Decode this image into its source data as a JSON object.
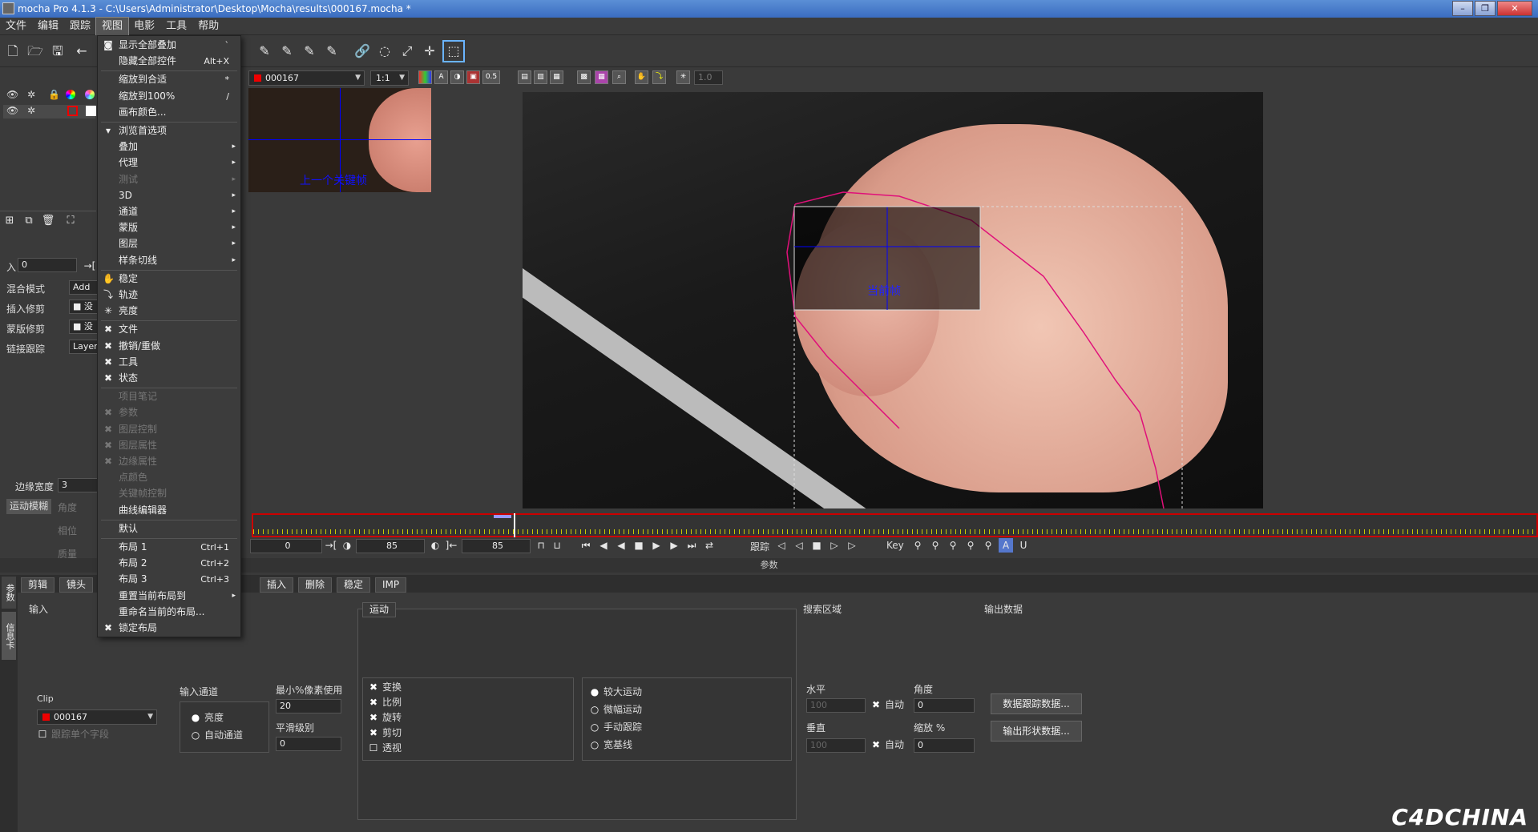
{
  "window": {
    "title": "mocha Pro 4.1.3 - C:\\Users\\Administrator\\Desktop\\Mocha\\results\\000167.mocha *",
    "minimize": "–",
    "restore": "❐",
    "close": "✕"
  },
  "menubar": [
    "文件",
    "编辑",
    "跟踪",
    "视图",
    "电影",
    "工具",
    "帮助"
  ],
  "clip_select": "000167",
  "zoom_select": "1:1",
  "opacity_value": "0.5",
  "speed_field": "1.0",
  "left": {
    "in_label": "入",
    "in_value": "0",
    "blend_label": "混合模式",
    "blend_value": "Add",
    "insert_label": "插入修剪",
    "mask_label": "蒙版修剪",
    "link_label": "链接跟踪",
    "link_value": "Layer",
    "edge_width_label": "边缘宽度",
    "edge_width_value": "3",
    "motion_blur_label": "运动模糊",
    "angle_label": "角度",
    "phase_label": "相位",
    "quality_label": "质量",
    "trunc": "没"
  },
  "thumb": {
    "label": "上一个关键帧"
  },
  "viewer": {
    "overlay_label": "当前帧"
  },
  "transport": {
    "in_value": "0",
    "frame1": "85",
    "frame2": "85",
    "track_label": "跟踪",
    "key_label": "Key"
  },
  "params_label": "参数",
  "tabs": [
    "剪辑",
    "镜头",
    "插入",
    "删除",
    "稳定",
    "IMP"
  ],
  "sidetabs": [
    "参数",
    "信息卡"
  ],
  "bottom": {
    "input_label": "输入",
    "clip_label": "Clip",
    "clip_value": "000167",
    "track_single": "跟踪单个字段",
    "input_channel_label": "输入通道",
    "luma": "亮度",
    "auto_channel": "自动通道",
    "min_pixel_label": "最小%像素使用",
    "min_pixel_value": "20",
    "smooth_label": "平滑级别",
    "smooth_value": "0",
    "motion_tab": "运动",
    "motion_checks": [
      "变换",
      "比例",
      "旋转",
      "剪切",
      "透视"
    ],
    "motion_radios": [
      "较大运动",
      "微幅运动",
      "手动跟踪",
      "宽基线"
    ],
    "search_label": "搜索区域",
    "output_label": "输出数据",
    "horiz_label": "水平",
    "vert_label": "垂直",
    "auto_label": "自动",
    "angle_label": "角度",
    "angle_value": "0",
    "zoom_label": "缩放 %",
    "zoom_value": "0",
    "h_value": "100",
    "v_value": "100",
    "export_track": "数据跟踪数据...",
    "export_shape": "输出形状数据..."
  },
  "menu": {
    "items": [
      {
        "label": "显示全部叠加",
        "shortcut": "`",
        "check": "◙"
      },
      {
        "label": "隐藏全部控件",
        "shortcut": "Alt+X",
        "check": ""
      },
      {
        "label": "缩放到合适",
        "shortcut": "*",
        "check": ""
      },
      {
        "label": "缩放到100%",
        "shortcut": "/",
        "check": ""
      },
      {
        "label": "画布颜色...",
        "shortcut": "",
        "check": ""
      },
      {
        "label": "浏览首选项",
        "shortcut": "",
        "check": "▾"
      },
      {
        "label": "叠加",
        "sub": "▸"
      },
      {
        "label": "代理",
        "sub": "▸"
      },
      {
        "label": "测试",
        "sub": "▸",
        "dis": true
      },
      {
        "label": "3D",
        "sub": "▸"
      },
      {
        "label": "通道",
        "sub": "▸"
      },
      {
        "label": "蒙版",
        "sub": "▸"
      },
      {
        "label": "图层",
        "sub": "▸"
      },
      {
        "label": "样条切线",
        "sub": "▸"
      },
      {
        "label": "稳定",
        "check": "✋"
      },
      {
        "label": "轨迹",
        "check": "⤵"
      },
      {
        "label": "亮度",
        "check": "✳"
      },
      {
        "label": "文件",
        "check": "✖"
      },
      {
        "label": "撤销/重做",
        "check": "✖"
      },
      {
        "label": "工具",
        "check": "✖"
      },
      {
        "label": "状态",
        "check": "✖"
      },
      {
        "label": "项目笔记",
        "dis": true
      },
      {
        "label": "参数",
        "dis": true,
        "check": "✖"
      },
      {
        "label": "图层控制",
        "dis": true,
        "check": "✖"
      },
      {
        "label": "图层属性",
        "dis": true,
        "check": "✖"
      },
      {
        "label": "边缘属性",
        "dis": true,
        "check": "✖"
      },
      {
        "label": "点颜色",
        "dis": true
      },
      {
        "label": "关键帧控制",
        "dis": true
      },
      {
        "label": "曲线编辑器",
        "check": ""
      },
      {
        "label": "默认"
      },
      {
        "label": "布局 1",
        "shortcut": "Ctrl+1"
      },
      {
        "label": "布局 2",
        "shortcut": "Ctrl+2"
      },
      {
        "label": "布局 3",
        "shortcut": "Ctrl+3"
      },
      {
        "label": "重置当前布局到",
        "sub": "▸"
      },
      {
        "label": "重命名当前的布局..."
      },
      {
        "label": "锁定布局",
        "check": "✖"
      }
    ]
  },
  "watermark": "C4DCHINA"
}
